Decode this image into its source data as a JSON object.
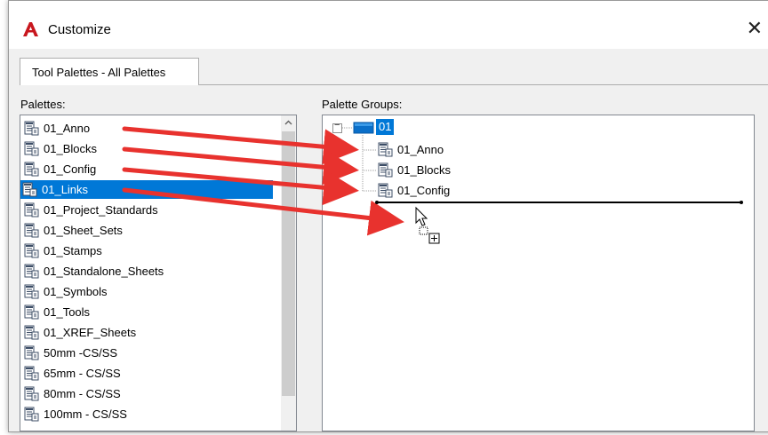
{
  "window": {
    "title": "Customize",
    "close_glyph": "✕"
  },
  "tabs": [
    {
      "label": "Tool Palettes - All Palettes"
    }
  ],
  "palettes": {
    "label": "Palettes:",
    "items": [
      {
        "label": "01_Anno"
      },
      {
        "label": "01_Blocks"
      },
      {
        "label": "01_Config"
      },
      {
        "label": "01_Links",
        "selected": true
      },
      {
        "label": "01_Project_Standards"
      },
      {
        "label": "01_Sheet_Sets"
      },
      {
        "label": "01_Stamps"
      },
      {
        "label": "01_Standalone_Sheets"
      },
      {
        "label": "01_Symbols"
      },
      {
        "label": "01_Tools"
      },
      {
        "label": "01_XREF_Sheets"
      },
      {
        "label": "50mm -CS/SS"
      },
      {
        "label": "65mm - CS/SS"
      },
      {
        "label": "80mm - CS/SS"
      },
      {
        "label": "100mm - CS/SS"
      }
    ]
  },
  "palette_groups": {
    "label": "Palette Groups:",
    "root": {
      "label": "01",
      "expand_glyph": "−"
    },
    "children": [
      {
        "label": "01_Anno"
      },
      {
        "label": "01_Blocks"
      },
      {
        "label": "01_Config"
      }
    ]
  },
  "colors": {
    "selection": "#0078d7",
    "arrow": "#e8322e",
    "logo": "#c8171e"
  },
  "icons": {
    "logo": "autocad-logo-icon",
    "palette": "tool-palette-icon",
    "group": "folder-icon",
    "cursor": "drag-copy-cursor-icon"
  }
}
